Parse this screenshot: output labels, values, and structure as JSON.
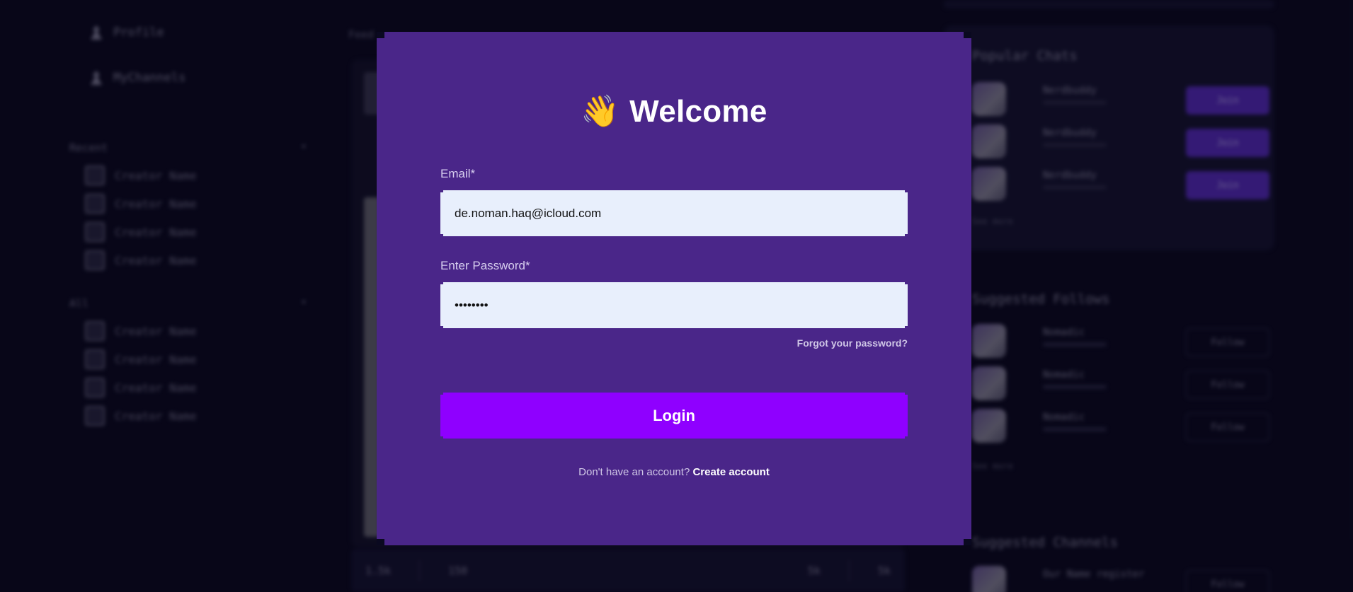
{
  "background": {
    "sidebar": {
      "nav": [
        {
          "label": "Profile"
        },
        {
          "label": "MyChannels"
        }
      ],
      "sections": [
        {
          "title": "Recent",
          "items": [
            "Creator Name",
            "Creator Name",
            "Creator Name",
            "Creator Name"
          ]
        },
        {
          "title": "All",
          "items": [
            "Creator Name",
            "Creator Name",
            "Creator Name",
            "Creator Name"
          ]
        }
      ]
    },
    "main": {
      "label": "Feed",
      "footer": [
        "1.5k",
        "150",
        "5k",
        "5k"
      ]
    },
    "right": {
      "popular_title": "Popular Chats",
      "popular": [
        {
          "name": "Nerdbuddy",
          "action": "Join"
        },
        {
          "name": "Nerdbuddy",
          "action": "Join"
        },
        {
          "name": "Nerdbuddy",
          "action": "Join"
        }
      ],
      "popular_more": "See more",
      "follows_title": "Suggested Follows",
      "follows": [
        {
          "name": "Nomadic",
          "action": "Follow"
        },
        {
          "name": "Nomadic",
          "action": "Follow"
        },
        {
          "name": "Nomadic",
          "action": "Follow"
        }
      ],
      "follows_more": "See more",
      "channels_title": "Suggested Channels",
      "channels": [
        {
          "name": "Our Name register",
          "action": "Follow"
        }
      ]
    }
  },
  "modal": {
    "icon": "waving-hand-icon",
    "title_emoji": "👋",
    "title": "Welcome",
    "email_label": "Email*",
    "email_value": "de.noman.haq@icloud.com",
    "password_label": "Enter Password*",
    "password_value": "••••••••",
    "forgot_label": "Forgot your password?",
    "login_label": "Login",
    "no_account_text": "Don't have an account?",
    "create_account_label": "Create account"
  },
  "colors": {
    "modal_bg": "#4a2689",
    "login_button": "#8f00ff",
    "input_bg": "#e8effc",
    "page_bg": "#0b0a1e"
  }
}
